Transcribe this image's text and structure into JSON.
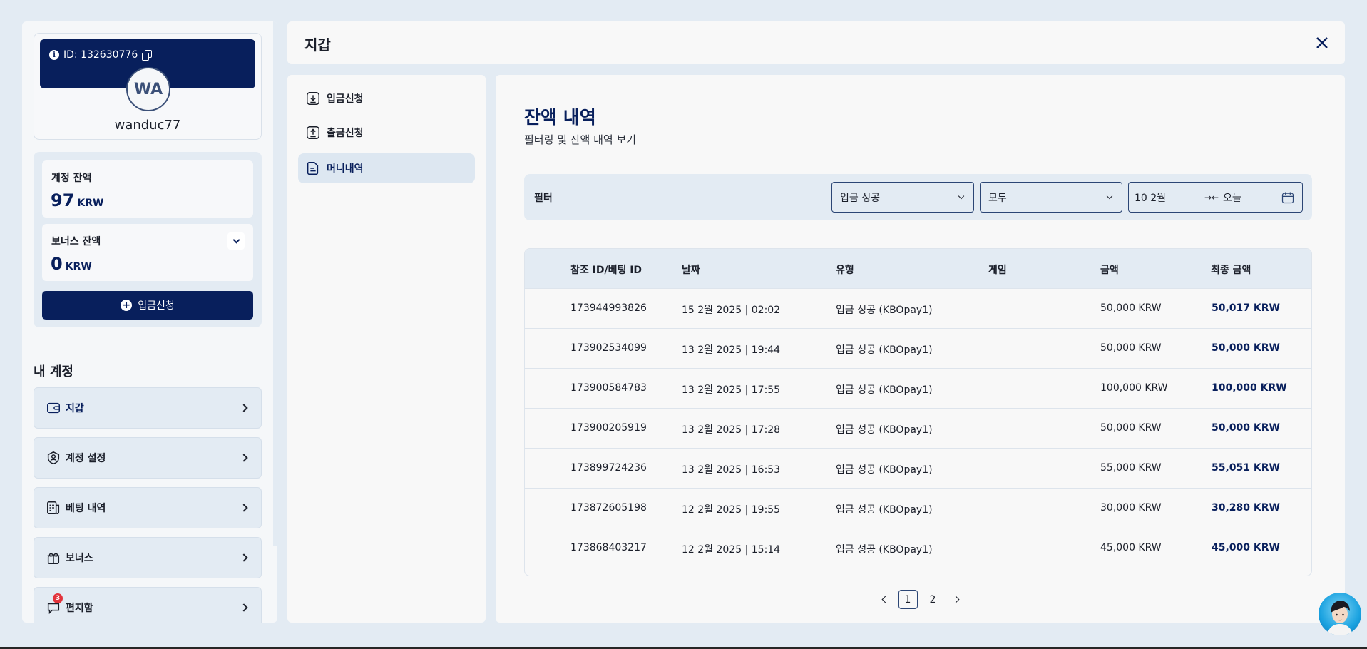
{
  "profile": {
    "id_label": "ID: 132630776",
    "initials": "WA",
    "username": "wanduc77"
  },
  "balance": {
    "account_label": "계정 잔액",
    "account_value": "97",
    "account_unit": "KRW",
    "bonus_label": "보너스 잔액",
    "bonus_value": "0",
    "bonus_unit": "KRW",
    "deposit_button": "입금신청"
  },
  "my_account": {
    "title": "내 계정",
    "items": [
      {
        "label": "지갑",
        "icon": "wallet-icon"
      },
      {
        "label": "계정 설정",
        "icon": "user-settings-icon"
      },
      {
        "label": "베팅 내역",
        "icon": "bet-history-icon"
      },
      {
        "label": "보너스",
        "icon": "gift-icon"
      },
      {
        "label": "편지함",
        "icon": "chat-icon",
        "badge": "3"
      }
    ]
  },
  "header": {
    "title": "지갑"
  },
  "subnav": {
    "items": [
      {
        "label": "입금신청",
        "icon": "download-icon"
      },
      {
        "label": "출금신청",
        "icon": "upload-icon"
      },
      {
        "label": "머니내역",
        "icon": "document-icon",
        "active": true
      }
    ]
  },
  "main": {
    "title": "잔액 내역",
    "subtitle": "필터링 및 잔액 내역 보기"
  },
  "filter": {
    "label": "필터",
    "type_select": "입금 성공",
    "scope_select": "모두",
    "date_from": "10 2월",
    "date_to": "오늘"
  },
  "table": {
    "headers": [
      "참조 ID/베팅 ID",
      "날짜",
      "유형",
      "게임",
      "금액",
      "최종 금액"
    ],
    "rows": [
      {
        "ref": "173944993826",
        "date": "15 2월 2025 | 02:02",
        "type": "입금 성공 (KBOpay1)",
        "game": "",
        "amount": "50,000 KRW",
        "final": "50,017 KRW"
      },
      {
        "ref": "173902534099",
        "date": "13 2월 2025 | 19:44",
        "type": "입금 성공 (KBOpay1)",
        "game": "",
        "amount": "50,000 KRW",
        "final": "50,000 KRW"
      },
      {
        "ref": "173900584783",
        "date": "13 2월 2025 | 17:55",
        "type": "입금 성공 (KBOpay1)",
        "game": "",
        "amount": "100,000 KRW",
        "final": "100,000 KRW"
      },
      {
        "ref": "173900205919",
        "date": "13 2월 2025 | 17:28",
        "type": "입금 성공 (KBOpay1)",
        "game": "",
        "amount": "50,000 KRW",
        "final": "50,000 KRW"
      },
      {
        "ref": "173899724236",
        "date": "13 2월 2025 | 16:53",
        "type": "입금 성공 (KBOpay1)",
        "game": "",
        "amount": "55,000 KRW",
        "final": "55,051 KRW"
      },
      {
        "ref": "173872605198",
        "date": "12 2월 2025 | 19:55",
        "type": "입금 성공 (KBOpay1)",
        "game": "",
        "amount": "30,000 KRW",
        "final": "30,280 KRW"
      },
      {
        "ref": "173868403217",
        "date": "12 2월 2025 | 15:14",
        "type": "입금 성공 (KBOpay1)",
        "game": "",
        "amount": "45,000 KRW",
        "final": "45,000 KRW"
      }
    ]
  },
  "pagination": {
    "pages": [
      "1",
      "2"
    ],
    "current": "1"
  },
  "colors": {
    "navy": "#081f5c",
    "panel": "#e3ebf3",
    "badge": "#e2333b"
  }
}
